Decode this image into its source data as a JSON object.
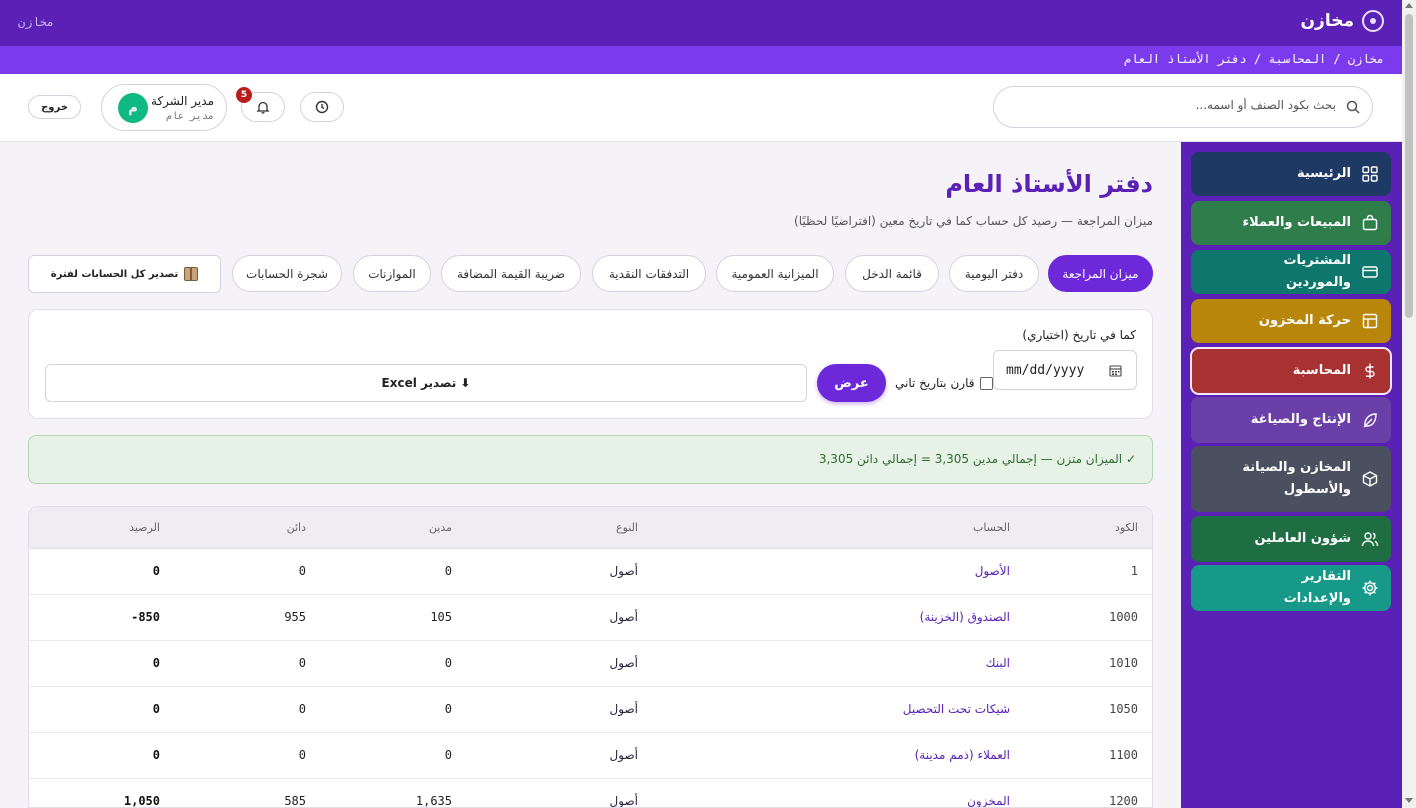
{
  "app": {
    "title": "مخازن",
    "top_left": "مخازن"
  },
  "breadcrumb": "مخازن / المحاسبة / دفتر الأستاذ العام",
  "search": {
    "placeholder": "بحث بكود الصنف أو اسمه..."
  },
  "notifications": {
    "count": "5"
  },
  "user": {
    "name": "مدير الشركة",
    "role": "مدير عام",
    "initial": "م"
  },
  "logout_label": "خروج",
  "colors": {
    "brand": "#5b21b6",
    "accent": "#6d28d9",
    "success_bg": "#e7f2e7"
  },
  "sidebar": {
    "items": [
      {
        "label": "الرئيسية",
        "icon": "grid-icon",
        "color": "#1e3a64"
      },
      {
        "label": "المبيعات والعملاء",
        "icon": "bag-icon",
        "color": "#2e7d4a"
      },
      {
        "label": "المشتريات والموردين",
        "icon": "card-icon",
        "color": "#0f766e"
      },
      {
        "label": "حركة المخزون",
        "icon": "table-icon",
        "color": "#b8860b"
      },
      {
        "label": "المحاسبة",
        "icon": "dollar-icon",
        "color": "#a83232",
        "active": true
      },
      {
        "label": "الإنتاج والصياغة",
        "icon": "feather-icon",
        "color": "#6b3fa8"
      },
      {
        "label": "المخازن والصيانة والأسطول",
        "icon": "cube-icon",
        "color": "#4b5060"
      },
      {
        "label": "شؤون العاملين",
        "icon": "users-icon",
        "color": "#1f6e43"
      },
      {
        "label": "التقارير والإعدادات",
        "icon": "settings-icon",
        "color": "#17998a"
      }
    ]
  },
  "page": {
    "title": "دفتر الأستاذ العام",
    "subtitle": "ميزان المراجعة — رصيد كل حساب كما في تاريخ معين (افتراضيًا لحظيًا)"
  },
  "tabs": [
    {
      "label": "ميزان المراجعة",
      "active": true
    },
    {
      "label": "دفتر اليومية"
    },
    {
      "label": "قائمة الدخل"
    },
    {
      "label": "الميزانية العمومية"
    },
    {
      "label": "التدفقات النقدية"
    },
    {
      "label": "ضريبة القيمة المضافة"
    },
    {
      "label": "الموازنات"
    },
    {
      "label": "شجرة الحسابات"
    }
  ],
  "export_all_label": "تصدير كل الحسابات لفترة",
  "filter": {
    "date_label": "كما في تاريخ (اختياري)",
    "date_value": "mm/dd/yyyy",
    "compare_label": "قارن بتاريخ تاني",
    "view_label": "عرض",
    "excel_label": "⬇ تصدير Excel"
  },
  "balance_message": "✓ الميزان متزن — إجمالي مدين 3,305 = إجمالي دائن 3,305",
  "table": {
    "headers": {
      "code": "الكود",
      "account": "الحساب",
      "type": "النوع",
      "debit": "مدين",
      "credit": "دائن",
      "balance": "الرصيد"
    },
    "rows": [
      {
        "code": "1",
        "account": "الأصول",
        "type": "أصول",
        "debit": "0",
        "credit": "0",
        "balance": "0"
      },
      {
        "code": "1000",
        "account": "الصندوق (الخزينة)",
        "type": "أصول",
        "debit": "105",
        "credit": "955",
        "balance": "-850"
      },
      {
        "code": "1010",
        "account": "البنك",
        "type": "أصول",
        "debit": "0",
        "credit": "0",
        "balance": "0"
      },
      {
        "code": "1050",
        "account": "شيكات تحت التحصيل",
        "type": "أصول",
        "debit": "0",
        "credit": "0",
        "balance": "0"
      },
      {
        "code": "1100",
        "account": "العملاء (ذمم مدينة)",
        "type": "أصول",
        "debit": "0",
        "credit": "0",
        "balance": "0"
      },
      {
        "code": "1200",
        "account": "المخزون",
        "type": "أصول",
        "debit": "1,635",
        "credit": "585",
        "balance": "1,050"
      }
    ]
  }
}
